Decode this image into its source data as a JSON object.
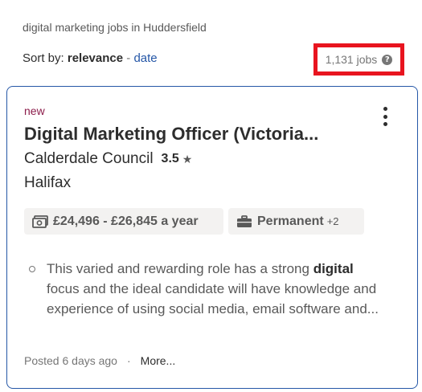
{
  "search": {
    "query_text": "digital marketing jobs in Huddersfield"
  },
  "sort": {
    "label": "Sort by:",
    "active": "relevance",
    "separator": "-",
    "alternative": "date"
  },
  "results": {
    "count_text": "1,131 jobs",
    "help_glyph": "?",
    "highlight_color": "#e8141f"
  },
  "job_card": {
    "badge": "new",
    "title": "Digital Marketing Officer (Victoria...",
    "company": "Calderdale Council",
    "rating": "3.5",
    "rating_icon": "star-icon",
    "location": "Halifax",
    "salary": "£24,496 - £26,845 a year",
    "salary_icon": "money-icon",
    "job_type": "Permanent",
    "job_type_extra": "+2",
    "job_type_icon": "briefcase-icon",
    "snippet": {
      "before": "This varied and rewarding role has a strong ",
      "highlight": "digital",
      "after": " focus and the ideal candidate will have knowledge and experience of using social media, email software and..."
    },
    "posted": "Posted 6 days ago",
    "footer_separator": "·",
    "more_label": "More...",
    "border_color": "#2557a7"
  }
}
